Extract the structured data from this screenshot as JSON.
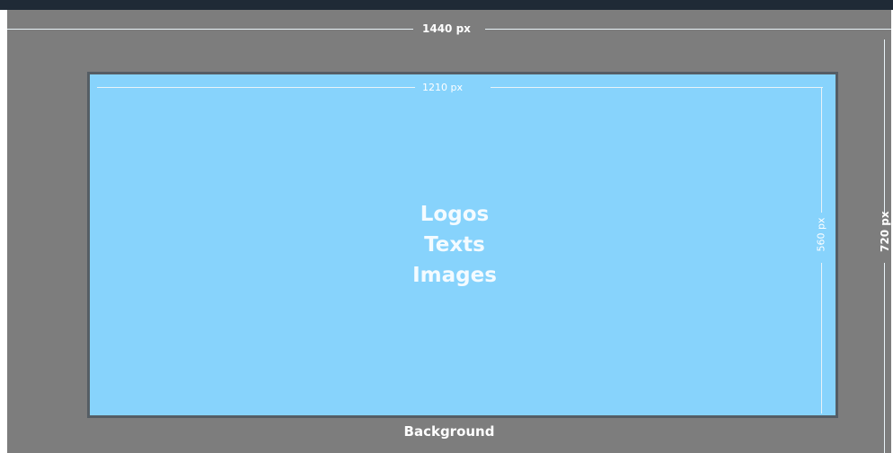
{
  "diagram": {
    "outer_width_label": "1440 px",
    "outer_height_label": "720 px",
    "inner_width_label": "1210 px",
    "inner_height_label": "560 px",
    "content_lines": [
      "Logos",
      "Texts",
      "Images"
    ],
    "background_label": "Background"
  },
  "colors": {
    "background": "#7d7d7d",
    "safe_area": "#87d3fc",
    "safe_area_border": "#555d64",
    "top_bar": "#1f2a36",
    "text": "#ffffff"
  }
}
